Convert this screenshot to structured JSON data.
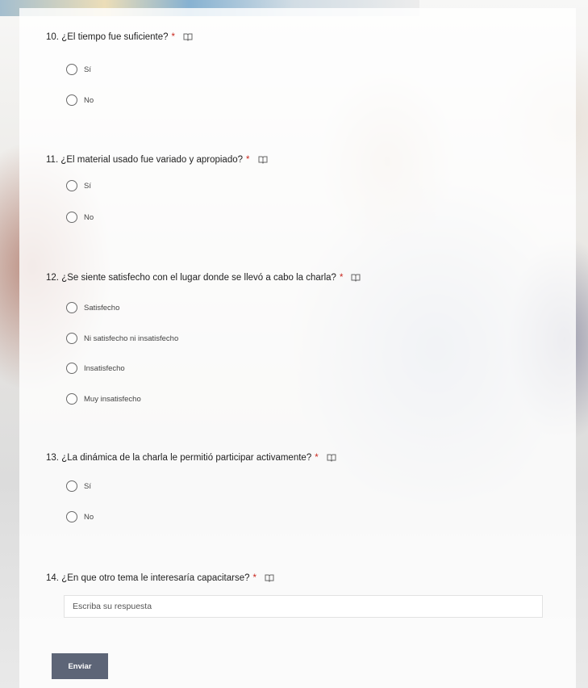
{
  "questions": [
    {
      "number": "10.",
      "text": "¿El tiempo fue suficiente?",
      "required_mark": "*",
      "options": [
        "Sí",
        "No"
      ]
    },
    {
      "number": "11.",
      "text": "¿El material usado fue variado y apropiado?",
      "required_mark": "*",
      "options": [
        "Sí",
        "No"
      ]
    },
    {
      "number": "12.",
      "text": "¿Se siente satisfecho con el lugar donde se llevó a cabo la charla?",
      "required_mark": "*",
      "options": [
        "Satisfecho",
        "Ni satisfecho ni insatisfecho",
        "Insatisfecho",
        "Muy insatisfecho"
      ]
    },
    {
      "number": "13.",
      "text": "¿La dinámica de la charla le permitió participar activamente?",
      "required_mark": "*",
      "options": [
        "Sí",
        "No"
      ]
    },
    {
      "number": "14.",
      "text": "¿En que otro tema le interesaría capacitarse?",
      "required_mark": "*",
      "placeholder": "Escriba su respuesta"
    }
  ],
  "submit_label": "Enviar",
  "colors": {
    "required": "#c9271e",
    "submit_bg": "#5d6577"
  },
  "icons": {
    "question_action": "immersive-reader-icon"
  }
}
